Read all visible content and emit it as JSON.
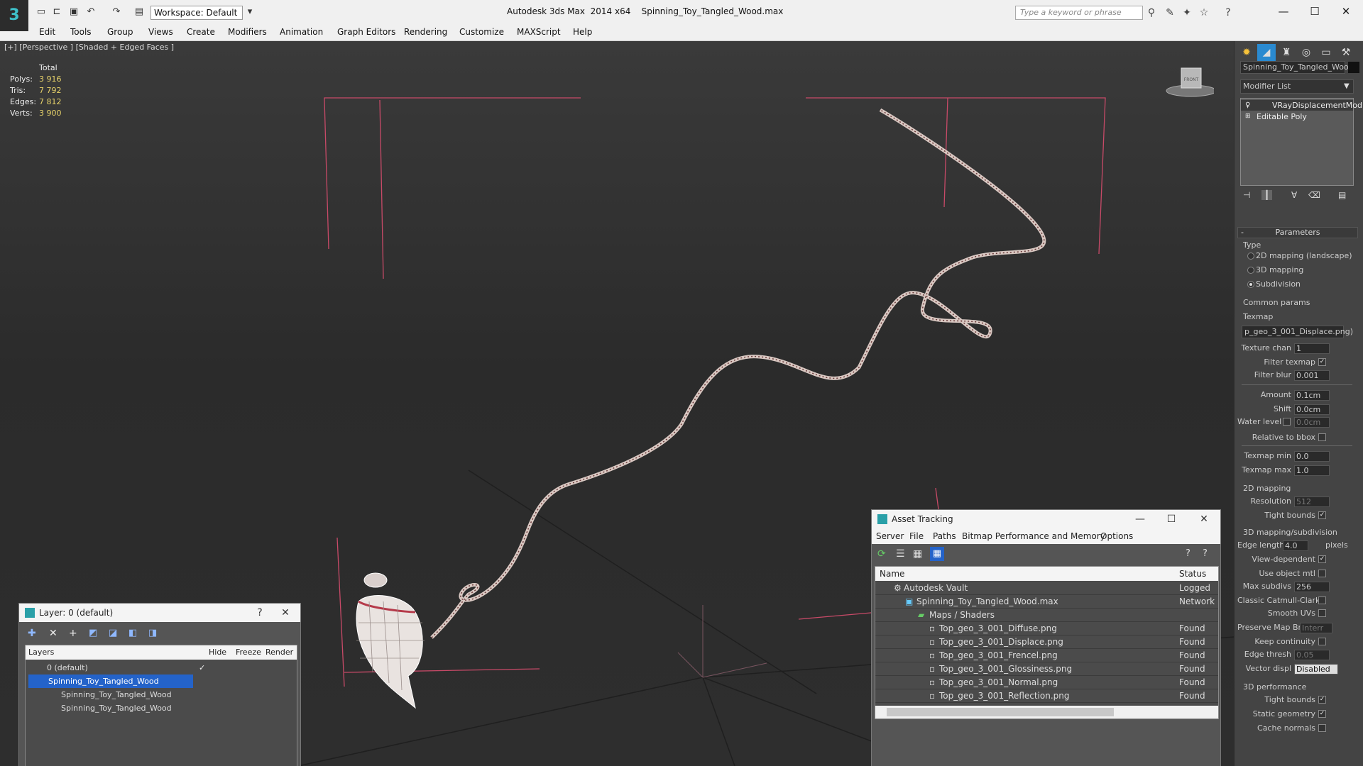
{
  "app": {
    "logo": "3",
    "workspace": "Workspace: Default",
    "title": "Autodesk 3ds Max  2014 x64",
    "filename": "Spinning_Toy_Tangled_Wood.max",
    "search_placeholder": "Type a keyword or phrase"
  },
  "menu": [
    "Edit",
    "Tools",
    "Group",
    "Views",
    "Create",
    "Modifiers",
    "Animation",
    "Graph Editors",
    "Rendering",
    "Customize",
    "MAXScript",
    "Help"
  ],
  "viewport": {
    "label": "[+] [Perspective ] [Shaded + Edged Faces ]",
    "stats_header": "Total",
    "stats": [
      {
        "label": "Polys:",
        "value": "3 916"
      },
      {
        "label": "Tris:",
        "value": "7 792"
      },
      {
        "label": "Edges:",
        "value": "7 812"
      },
      {
        "label": "Verts:",
        "value": "3 900"
      }
    ],
    "viewcube_label": "FRONT"
  },
  "command_panel": {
    "object_name": "Spinning_Toy_Tangled_Wood",
    "modifier_list": "Modifier List",
    "stack": [
      "VRayDisplacementMod",
      "Editable Poly"
    ],
    "parameters_title": "Parameters",
    "minus": "-",
    "type_label": "Type",
    "type_options": [
      "2D mapping (landscape)",
      "3D mapping",
      "Subdivision"
    ],
    "common_params": "Common params",
    "texmap_label": "Texmap",
    "texmap_value": "p_geo_3_001_Displace.png)",
    "texture_chan": {
      "label": "Texture chan",
      "value": "1"
    },
    "filter_texmap": "Filter texmap",
    "filter_blur": {
      "label": "Filter blur",
      "value": "0.001"
    },
    "amount": {
      "label": "Amount",
      "value": "0.1cm"
    },
    "shift": {
      "label": "Shift",
      "value": "0.0cm"
    },
    "water_level": {
      "label": "Water level",
      "value": "0.0cm"
    },
    "relative_bbox": "Relative to bbox",
    "texmap_min": {
      "label": "Texmap min",
      "value": "0.0"
    },
    "texmap_max": {
      "label": "Texmap max",
      "value": "1.0"
    },
    "mapping2d": "2D mapping",
    "resolution": {
      "label": "Resolution",
      "value": "512"
    },
    "tight_bounds": "Tight bounds",
    "mapping3d": "3D mapping/subdivision",
    "edge_length": {
      "label": "Edge length",
      "value": "4.0",
      "unit": "pixels"
    },
    "view_dependent": "View-dependent",
    "use_object_mtl": "Use object mtl",
    "max_subdivs": {
      "label": "Max subdivs",
      "value": "256"
    },
    "classic_catmull": "Classic Catmull-Clark",
    "smooth_uvs": "Smooth UVs",
    "preserve_map": {
      "label": "Preserve Map Bnd",
      "value": "Interr"
    },
    "keep_continuity": "Keep continuity",
    "edge_thresh": {
      "label": "Edge thresh",
      "value": "0.05"
    },
    "vector_displ": {
      "label": "Vector displ",
      "value": "Disabled"
    },
    "perf_title": "3D performance",
    "perf_tight_bounds": "Tight bounds",
    "static_geometry": "Static geometry",
    "cache_normals": "Cache normals"
  },
  "layer_dialog": {
    "title": "Layer: 0 (default)",
    "help": "?",
    "columns": [
      "Layers",
      "Hide",
      "Freeze",
      "Render"
    ],
    "rows": [
      "0 (default)",
      "Spinning_Toy_Tangled_Wood",
      "Spinning_Toy_Tangled_Wood",
      "Spinning_Toy_Tangled_Wood"
    ]
  },
  "asset_dialog": {
    "title": "Asset Tracking",
    "menu": [
      "Server",
      "File",
      "Paths",
      "Bitmap Performance and Memory",
      "Options"
    ],
    "columns": [
      "Name",
      "Status"
    ],
    "rows": [
      {
        "name": "Autodesk Vault",
        "status": "Logged"
      },
      {
        "name": "Spinning_Toy_Tangled_Wood.max",
        "status": "Network"
      },
      {
        "name": "Maps / Shaders",
        "status": ""
      },
      {
        "name": "Top_geo_3_001_Diffuse.png",
        "status": "Found"
      },
      {
        "name": "Top_geo_3_001_Displace.png",
        "status": "Found"
      },
      {
        "name": "Top_geo_3_001_Frencel.png",
        "status": "Found"
      },
      {
        "name": "Top_geo_3_001_Glossiness.png",
        "status": "Found"
      },
      {
        "name": "Top_geo_3_001_Normal.png",
        "status": "Found"
      },
      {
        "name": "Top_geo_3_001_Reflection.png",
        "status": "Found"
      }
    ]
  }
}
